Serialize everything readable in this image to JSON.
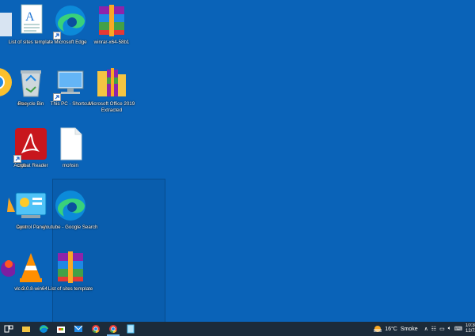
{
  "desktop": {
    "icons": [
      {
        "label": "List of sites template"
      },
      {
        "label": "Microsoft Edge"
      },
      {
        "label": "winrar-x64-58b1"
      },
      {
        "label": "ome"
      },
      {
        "label": "Recycle Bin"
      },
      {
        "label": "This PC - Shortcut"
      },
      {
        "label": "Microsoft Office 2019 Extracted"
      },
      {
        "label": "ogle"
      },
      {
        "label": "Acrobat Reader"
      },
      {
        "label": "mohsin"
      },
      {
        "label": "ayer"
      },
      {
        "label": "Control Panel"
      },
      {
        "label": "youtube - Google Search"
      },
      {
        "label": "n -"
      },
      {
        "label": "vlc-3.0.8-win64"
      },
      {
        "label": "List of sites template"
      }
    ]
  },
  "taskbar": {
    "weather_temp": "16°C",
    "weather_desc": "Smoke",
    "clock_time": "10:30",
    "clock_date": "12/7/"
  },
  "colors": {
    "desktop_bg": "#0a63b8",
    "taskbar_bg": "#1c2b3a"
  }
}
